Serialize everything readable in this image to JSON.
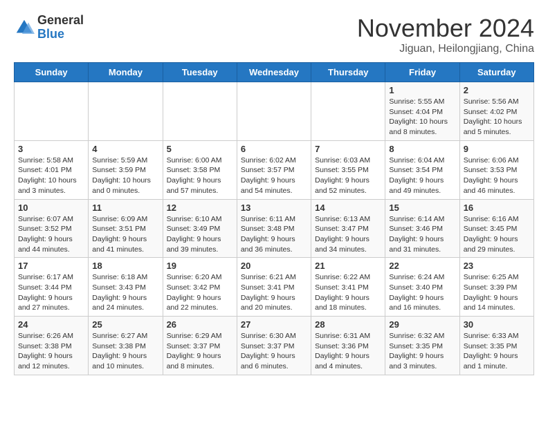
{
  "header": {
    "logo_general": "General",
    "logo_blue": "Blue",
    "month_title": "November 2024",
    "location": "Jiguan, Heilongjiang, China"
  },
  "days_of_week": [
    "Sunday",
    "Monday",
    "Tuesday",
    "Wednesday",
    "Thursday",
    "Friday",
    "Saturday"
  ],
  "weeks": [
    [
      {
        "day": "",
        "info": ""
      },
      {
        "day": "",
        "info": ""
      },
      {
        "day": "",
        "info": ""
      },
      {
        "day": "",
        "info": ""
      },
      {
        "day": "",
        "info": ""
      },
      {
        "day": "1",
        "info": "Sunrise: 5:55 AM\nSunset: 4:04 PM\nDaylight: 10 hours\nand 8 minutes."
      },
      {
        "day": "2",
        "info": "Sunrise: 5:56 AM\nSunset: 4:02 PM\nDaylight: 10 hours\nand 5 minutes."
      }
    ],
    [
      {
        "day": "3",
        "info": "Sunrise: 5:58 AM\nSunset: 4:01 PM\nDaylight: 10 hours\nand 3 minutes."
      },
      {
        "day": "4",
        "info": "Sunrise: 5:59 AM\nSunset: 3:59 PM\nDaylight: 10 hours\nand 0 minutes."
      },
      {
        "day": "5",
        "info": "Sunrise: 6:00 AM\nSunset: 3:58 PM\nDaylight: 9 hours\nand 57 minutes."
      },
      {
        "day": "6",
        "info": "Sunrise: 6:02 AM\nSunset: 3:57 PM\nDaylight: 9 hours\nand 54 minutes."
      },
      {
        "day": "7",
        "info": "Sunrise: 6:03 AM\nSunset: 3:55 PM\nDaylight: 9 hours\nand 52 minutes."
      },
      {
        "day": "8",
        "info": "Sunrise: 6:04 AM\nSunset: 3:54 PM\nDaylight: 9 hours\nand 49 minutes."
      },
      {
        "day": "9",
        "info": "Sunrise: 6:06 AM\nSunset: 3:53 PM\nDaylight: 9 hours\nand 46 minutes."
      }
    ],
    [
      {
        "day": "10",
        "info": "Sunrise: 6:07 AM\nSunset: 3:52 PM\nDaylight: 9 hours\nand 44 minutes."
      },
      {
        "day": "11",
        "info": "Sunrise: 6:09 AM\nSunset: 3:51 PM\nDaylight: 9 hours\nand 41 minutes."
      },
      {
        "day": "12",
        "info": "Sunrise: 6:10 AM\nSunset: 3:49 PM\nDaylight: 9 hours\nand 39 minutes."
      },
      {
        "day": "13",
        "info": "Sunrise: 6:11 AM\nSunset: 3:48 PM\nDaylight: 9 hours\nand 36 minutes."
      },
      {
        "day": "14",
        "info": "Sunrise: 6:13 AM\nSunset: 3:47 PM\nDaylight: 9 hours\nand 34 minutes."
      },
      {
        "day": "15",
        "info": "Sunrise: 6:14 AM\nSunset: 3:46 PM\nDaylight: 9 hours\nand 31 minutes."
      },
      {
        "day": "16",
        "info": "Sunrise: 6:16 AM\nSunset: 3:45 PM\nDaylight: 9 hours\nand 29 minutes."
      }
    ],
    [
      {
        "day": "17",
        "info": "Sunrise: 6:17 AM\nSunset: 3:44 PM\nDaylight: 9 hours\nand 27 minutes."
      },
      {
        "day": "18",
        "info": "Sunrise: 6:18 AM\nSunset: 3:43 PM\nDaylight: 9 hours\nand 24 minutes."
      },
      {
        "day": "19",
        "info": "Sunrise: 6:20 AM\nSunset: 3:42 PM\nDaylight: 9 hours\nand 22 minutes."
      },
      {
        "day": "20",
        "info": "Sunrise: 6:21 AM\nSunset: 3:41 PM\nDaylight: 9 hours\nand 20 minutes."
      },
      {
        "day": "21",
        "info": "Sunrise: 6:22 AM\nSunset: 3:41 PM\nDaylight: 9 hours\nand 18 minutes."
      },
      {
        "day": "22",
        "info": "Sunrise: 6:24 AM\nSunset: 3:40 PM\nDaylight: 9 hours\nand 16 minutes."
      },
      {
        "day": "23",
        "info": "Sunrise: 6:25 AM\nSunset: 3:39 PM\nDaylight: 9 hours\nand 14 minutes."
      }
    ],
    [
      {
        "day": "24",
        "info": "Sunrise: 6:26 AM\nSunset: 3:38 PM\nDaylight: 9 hours\nand 12 minutes."
      },
      {
        "day": "25",
        "info": "Sunrise: 6:27 AM\nSunset: 3:38 PM\nDaylight: 9 hours\nand 10 minutes."
      },
      {
        "day": "26",
        "info": "Sunrise: 6:29 AM\nSunset: 3:37 PM\nDaylight: 9 hours\nand 8 minutes."
      },
      {
        "day": "27",
        "info": "Sunrise: 6:30 AM\nSunset: 3:37 PM\nDaylight: 9 hours\nand 6 minutes."
      },
      {
        "day": "28",
        "info": "Sunrise: 6:31 AM\nSunset: 3:36 PM\nDaylight: 9 hours\nand 4 minutes."
      },
      {
        "day": "29",
        "info": "Sunrise: 6:32 AM\nSunset: 3:35 PM\nDaylight: 9 hours\nand 3 minutes."
      },
      {
        "day": "30",
        "info": "Sunrise: 6:33 AM\nSunset: 3:35 PM\nDaylight: 9 hours\nand 1 minute."
      }
    ]
  ]
}
